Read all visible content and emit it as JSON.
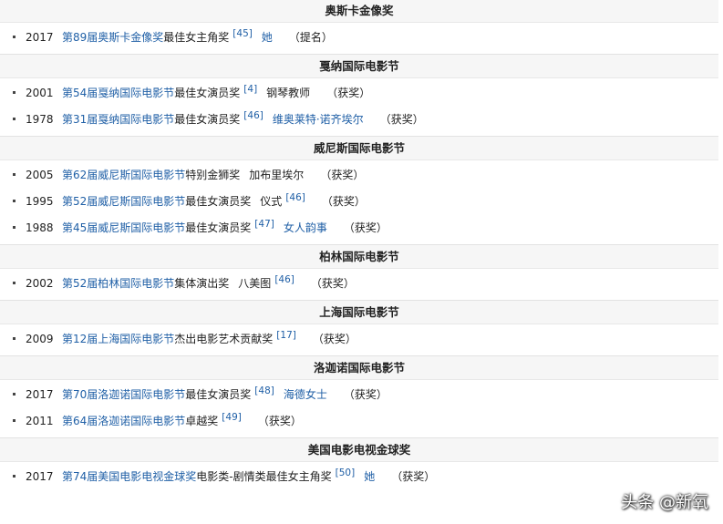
{
  "sections": [
    {
      "title": "奥斯卡金像奖",
      "rows": [
        {
          "year": "2017",
          "link": "第89届奥斯卡金像奖",
          "award": "最佳女主角奖",
          "ref": "[45]",
          "work": "她",
          "work_is_link": true,
          "result": "（提名）"
        }
      ]
    },
    {
      "title": "戛纳国际电影节",
      "rows": [
        {
          "year": "2001",
          "link": "第54届戛纳国际电影节",
          "award": "最佳女演员奖",
          "ref": "[4]",
          "work": "钢琴教师",
          "work_is_link": false,
          "result": "（获奖）"
        },
        {
          "year": "1978",
          "link": "第31届戛纳国际电影节",
          "award": "最佳女演员奖",
          "ref": "[46]",
          "work": "维奥莱特·诺齐埃尔",
          "work_is_link": true,
          "result": "（获奖）"
        }
      ]
    },
    {
      "title": "威尼斯国际电影节",
      "rows": [
        {
          "year": "2005",
          "link": "第62届威尼斯国际电影节",
          "award": "特别金狮奖",
          "ref": "",
          "work": "加布里埃尔",
          "work_is_link": false,
          "result": "（获奖）"
        },
        {
          "year": "1995",
          "link": "第52届威尼斯国际电影节",
          "award": "最佳女演员奖",
          "ref": "",
          "work": "仪式",
          "work_is_link": false,
          "work_ref": "[46]",
          "result": "（获奖）"
        },
        {
          "year": "1988",
          "link": "第45届威尼斯国际电影节",
          "award": "最佳女演员奖",
          "ref": "[47]",
          "work": "女人韵事",
          "work_is_link": true,
          "result": "（获奖）"
        }
      ]
    },
    {
      "title": "柏林国际电影节",
      "rows": [
        {
          "year": "2002",
          "link": "第52届柏林国际电影节",
          "award": "集体演出奖",
          "ref": "",
          "work": "八美图",
          "work_is_link": false,
          "work_ref": "[46]",
          "result": "（获奖）"
        }
      ]
    },
    {
      "title": "上海国际电影节",
      "rows": [
        {
          "year": "2009",
          "link": "第12届上海国际电影节",
          "award": "杰出电影艺术贡献奖",
          "ref": "[17]",
          "work": "",
          "work_is_link": false,
          "result": "（获奖）"
        }
      ]
    },
    {
      "title": "洛迦诺国际电影节",
      "rows": [
        {
          "year": "2017",
          "link": "第70届洛迦诺国际电影节",
          "award": "最佳女演员奖",
          "ref": "[48]",
          "work": "海德女士",
          "work_is_link": true,
          "result": "（获奖）"
        },
        {
          "year": "2011",
          "link": "第64届洛迦诺国际电影节",
          "award": "卓越奖",
          "ref": "[49]",
          "work": "",
          "work_is_link": false,
          "result": "（获奖）"
        }
      ]
    },
    {
      "title": "美国电影电视金球奖",
      "rows": [
        {
          "year": "2017",
          "link": "第74届美国电影电视金球奖",
          "award": "电影类-剧情类最佳女主角奖",
          "ref": "[50]",
          "work": "她",
          "work_is_link": true,
          "result": "（获奖）"
        }
      ]
    }
  ],
  "watermark": "头条 @新氧",
  "colors": {
    "link": "#1f5fa6",
    "header_bg": "#f6f6f6",
    "text": "#222222"
  }
}
